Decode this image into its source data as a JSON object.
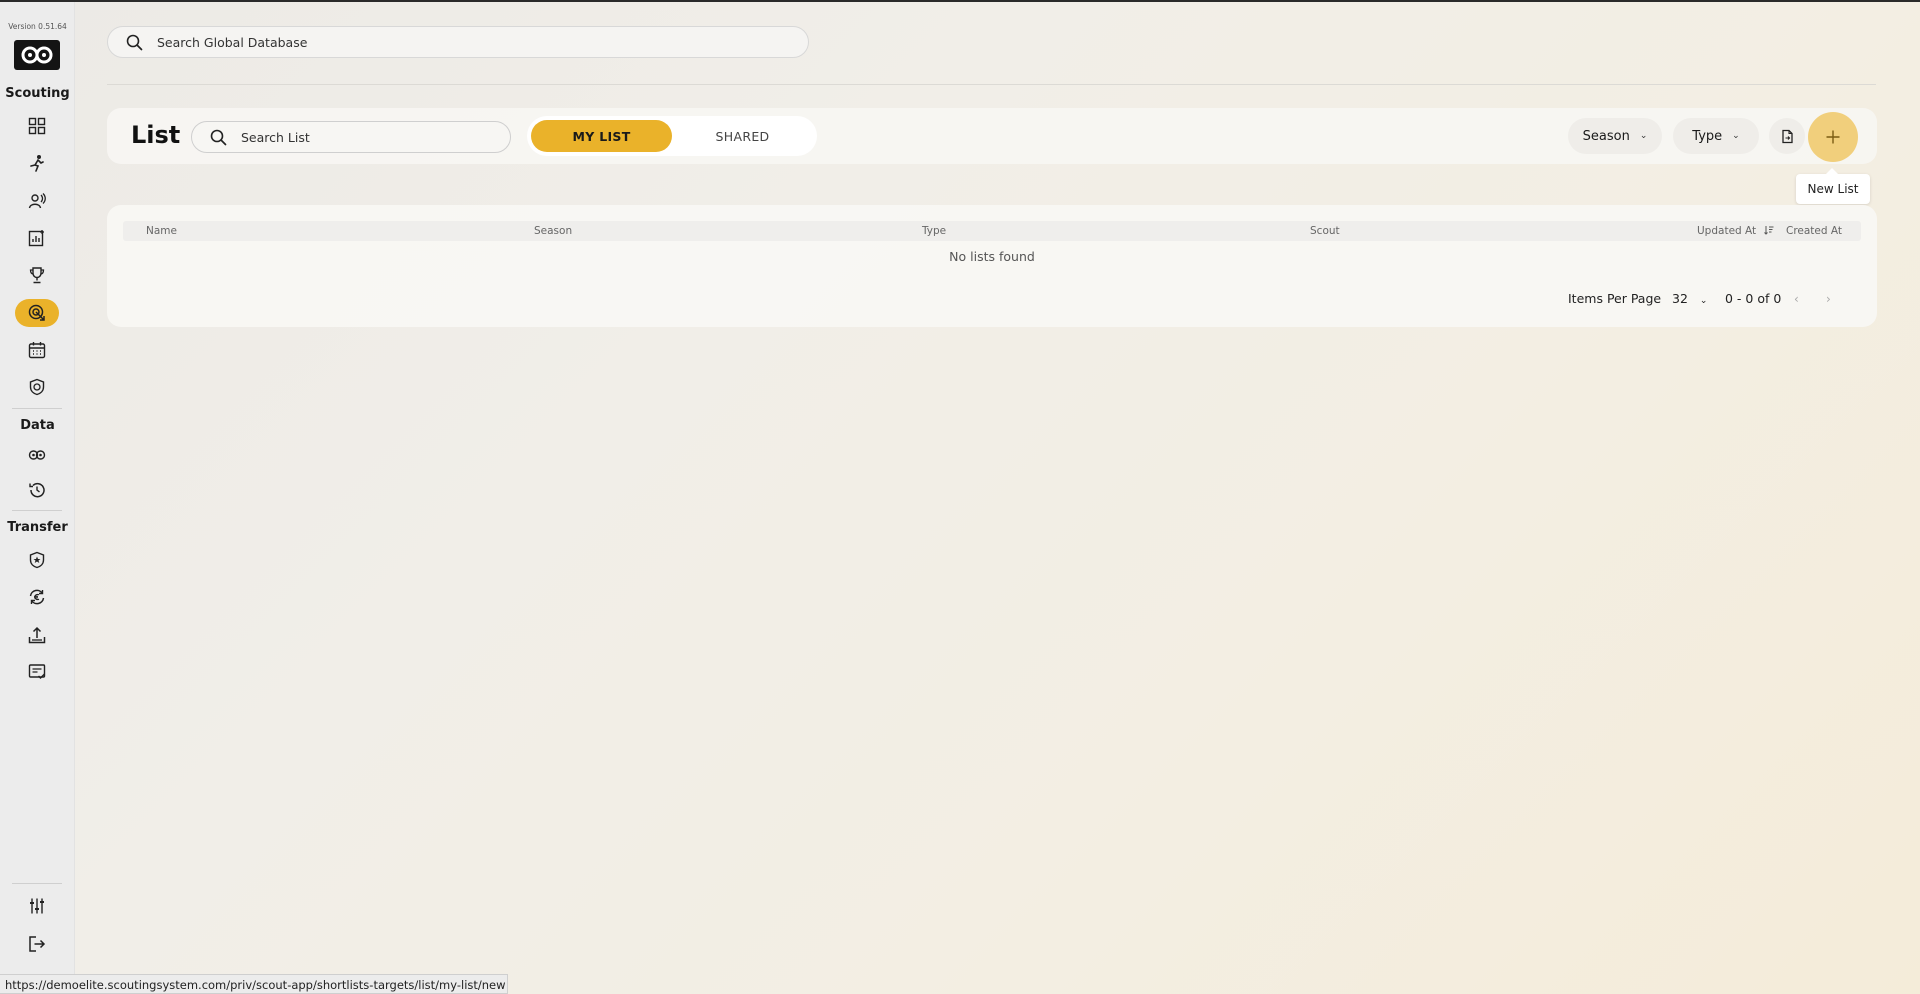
{
  "sidebar": {
    "version": "Version 0.51.64",
    "sections": {
      "scouting": "Scouting",
      "data": "Data",
      "transfer": "Transfer"
    },
    "items": [
      {
        "name": "dashboard-icon",
        "active": false
      },
      {
        "name": "player-icon",
        "active": false
      },
      {
        "name": "scout-icon",
        "active": false
      },
      {
        "name": "report-icon",
        "active": false
      },
      {
        "name": "trophy-icon",
        "active": false
      },
      {
        "name": "target-icon",
        "active": true
      },
      {
        "name": "calendar-icon",
        "active": false
      },
      {
        "name": "shield-icon",
        "active": false
      },
      {
        "name": "data-icon",
        "active": false
      },
      {
        "name": "history-icon",
        "active": false
      },
      {
        "name": "club-icon",
        "active": false
      },
      {
        "name": "euro-exchange-icon",
        "active": false
      },
      {
        "name": "upload-icon",
        "active": false
      },
      {
        "name": "checklist-icon",
        "active": false
      },
      {
        "name": "settings-sliders-icon",
        "active": false
      },
      {
        "name": "logout-icon",
        "active": false
      }
    ]
  },
  "global_search": {
    "placeholder": "Search Global Database"
  },
  "toolbar": {
    "title": "List",
    "search_placeholder": "Search List",
    "tabs": [
      {
        "label": "MY LIST",
        "active": true
      },
      {
        "label": "SHARED",
        "active": false
      }
    ],
    "filters": {
      "season": "Season",
      "type": "Type"
    },
    "new_list_tooltip": "New List"
  },
  "table": {
    "columns": [
      "Name",
      "Season",
      "Type",
      "Scout",
      "Updated At",
      "Created At"
    ],
    "empty_message": "No lists found",
    "pagination": {
      "items_per_page_label": "Items Per Page",
      "items_per_page": "32",
      "range": "0 - 0 of 0"
    }
  },
  "status_url": "https://demoelite.scoutingsystem.com/priv/scout-app/shortlists-targets/list/my-list/new",
  "colors": {
    "accent": "#eab22a",
    "accent_light": "#f1cf7c"
  }
}
